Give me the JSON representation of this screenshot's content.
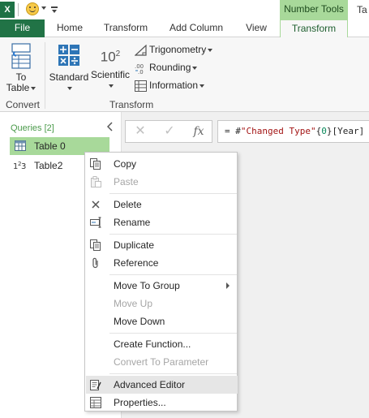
{
  "qat": {
    "logo_text": "X",
    "context_group": "Number Tools",
    "partial_tab": "Ta"
  },
  "tabs": {
    "file": "File",
    "home": "Home",
    "transform": "Transform",
    "add_column": "Add Column",
    "view": "View",
    "transform_active": "Transform"
  },
  "ribbon": {
    "to_table_line1": "To",
    "to_table_line2": "Table",
    "standard": "Standard",
    "scientific": "Scientific",
    "scientific_glyph": "10",
    "scientific_exp": "2",
    "trigonometry": "Trigonometry",
    "rounding": "Rounding",
    "information": "Information",
    "group_convert": "Convert",
    "group_transform": "Transform"
  },
  "queries": {
    "header": "Queries [2]",
    "items": [
      {
        "label": "Table 0",
        "icon": "table-icon",
        "selected": true
      },
      {
        "label": "Table2",
        "icon": "number-123-icon",
        "selected": false
      }
    ]
  },
  "formula_bar": {
    "cancel_glyph": "✕",
    "commit_glyph": "✓",
    "fx_glyph": "fx",
    "parts": {
      "p1": "= #",
      "p2": "\"Changed Type\"",
      "p3": "{",
      "p4": "0",
      "p5": "}[Year]"
    }
  },
  "context_menu": {
    "copy": "Copy",
    "paste": "Paste",
    "delete": "Delete",
    "rename": "Rename",
    "duplicate": "Duplicate",
    "reference": "Reference",
    "move_to_group": "Move To Group",
    "move_up": "Move Up",
    "move_down": "Move Down",
    "create_function": "Create Function...",
    "convert_to_parameter": "Convert To Parameter",
    "advanced_editor": "Advanced Editor",
    "properties": "Properties..."
  },
  "colors": {
    "excel_green": "#217346",
    "selection_green": "#a8d99a",
    "header_green": "#4a9a4a",
    "menu_hover": "#e6e6e6"
  }
}
